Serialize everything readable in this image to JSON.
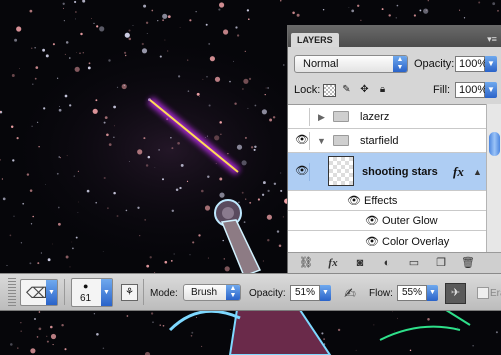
{
  "colors": {
    "canvas_bg": "#06060a",
    "laser_core": "#ffdd55",
    "laser_glow": "#cc33ff",
    "selection": "#aecdf3",
    "accent_blue": "#3b7be0"
  },
  "layers_panel": {
    "tab_title": "LAYERS",
    "tab_close": "×",
    "menu_icon": "▾≡",
    "blend_mode": "Normal",
    "opacity_label": "Opacity:",
    "opacity_value": "100%",
    "lock_label": "Lock:",
    "fill_label": "Fill:",
    "fill_value": "100%",
    "layers": [
      {
        "name": "lazerz",
        "type": "group",
        "expanded": false,
        "visible": false
      },
      {
        "name": "starfield",
        "type": "group",
        "expanded": true,
        "visible": true
      },
      {
        "name": "shooting stars",
        "type": "layer",
        "selected": true,
        "visible": true,
        "fx": "fx"
      },
      {
        "name": "Effects",
        "type": "effects-header"
      },
      {
        "name": "Outer Glow",
        "type": "effect"
      },
      {
        "name": "Color Overlay",
        "type": "effect"
      }
    ],
    "footer_icons": [
      "link-icon",
      "fx-icon",
      "mask-icon",
      "adjustment-icon",
      "folder-icon",
      "new-layer-icon",
      "trash-icon"
    ]
  },
  "options_bar": {
    "brush_size": "61",
    "mode_label": "Mode:",
    "mode_value": "Brush",
    "opacity_label": "Opacity:",
    "opacity_value": "51%",
    "flow_label": "Flow:",
    "flow_value": "55%",
    "erase_label": "Era"
  }
}
